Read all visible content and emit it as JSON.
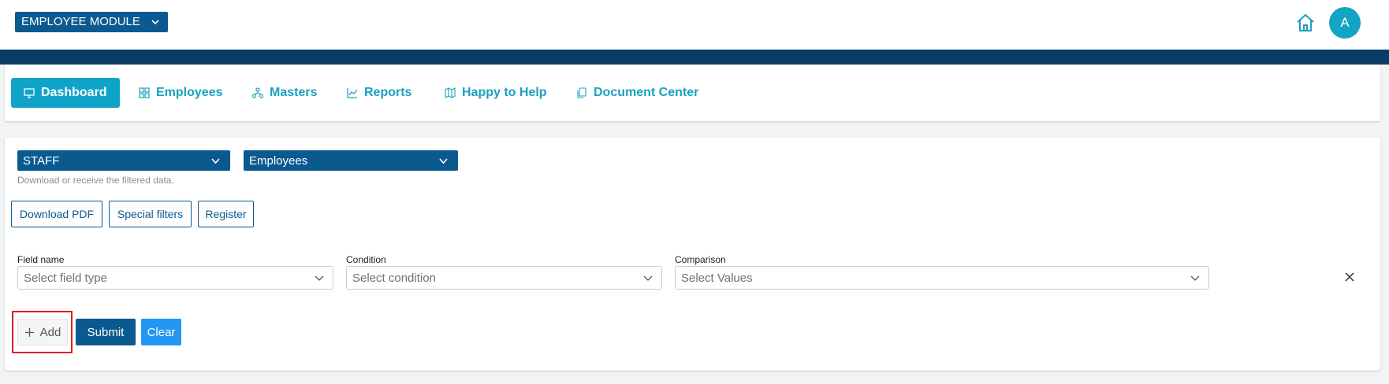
{
  "header": {
    "module_select": "EMPLOYEE MODULE",
    "avatar_letter": "A",
    "icons": [
      "chevron-down-icon",
      "home-icon"
    ]
  },
  "nav": {
    "items": [
      {
        "label": "Dashboard",
        "icon": "monitor-icon",
        "active": true
      },
      {
        "label": "Employees",
        "icon": "grid-icon"
      },
      {
        "label": "Masters",
        "icon": "hierarchy-icon"
      },
      {
        "label": "Reports",
        "icon": "line-chart-icon"
      },
      {
        "label": "Happy to Help",
        "icon": "map-icon"
      },
      {
        "label": "Document Center",
        "icon": "document-icon"
      }
    ]
  },
  "filters": {
    "type_select": "STAFF",
    "entity_select": "Employees",
    "hint": "Download or receive the filtered data.",
    "buttons": {
      "download_pdf": "Download PDF",
      "special_filters": "Special filters",
      "register": "Register"
    },
    "row": {
      "field_label": "Field name",
      "field_placeholder": "Select field type",
      "condition_label": "Condition",
      "condition_placeholder": "Select condition",
      "comparison_label": "Comparison",
      "comparison_placeholder": "Select Values"
    },
    "actions": {
      "add": "Add",
      "submit": "Submit",
      "clear": "Clear"
    }
  },
  "colors": {
    "primary_dark": "#0b5a8f",
    "nav_bar": "#0a3d66",
    "accent_teal": "#10a3c9",
    "clear_blue": "#2196f3",
    "highlight_red": "#e31b23"
  }
}
